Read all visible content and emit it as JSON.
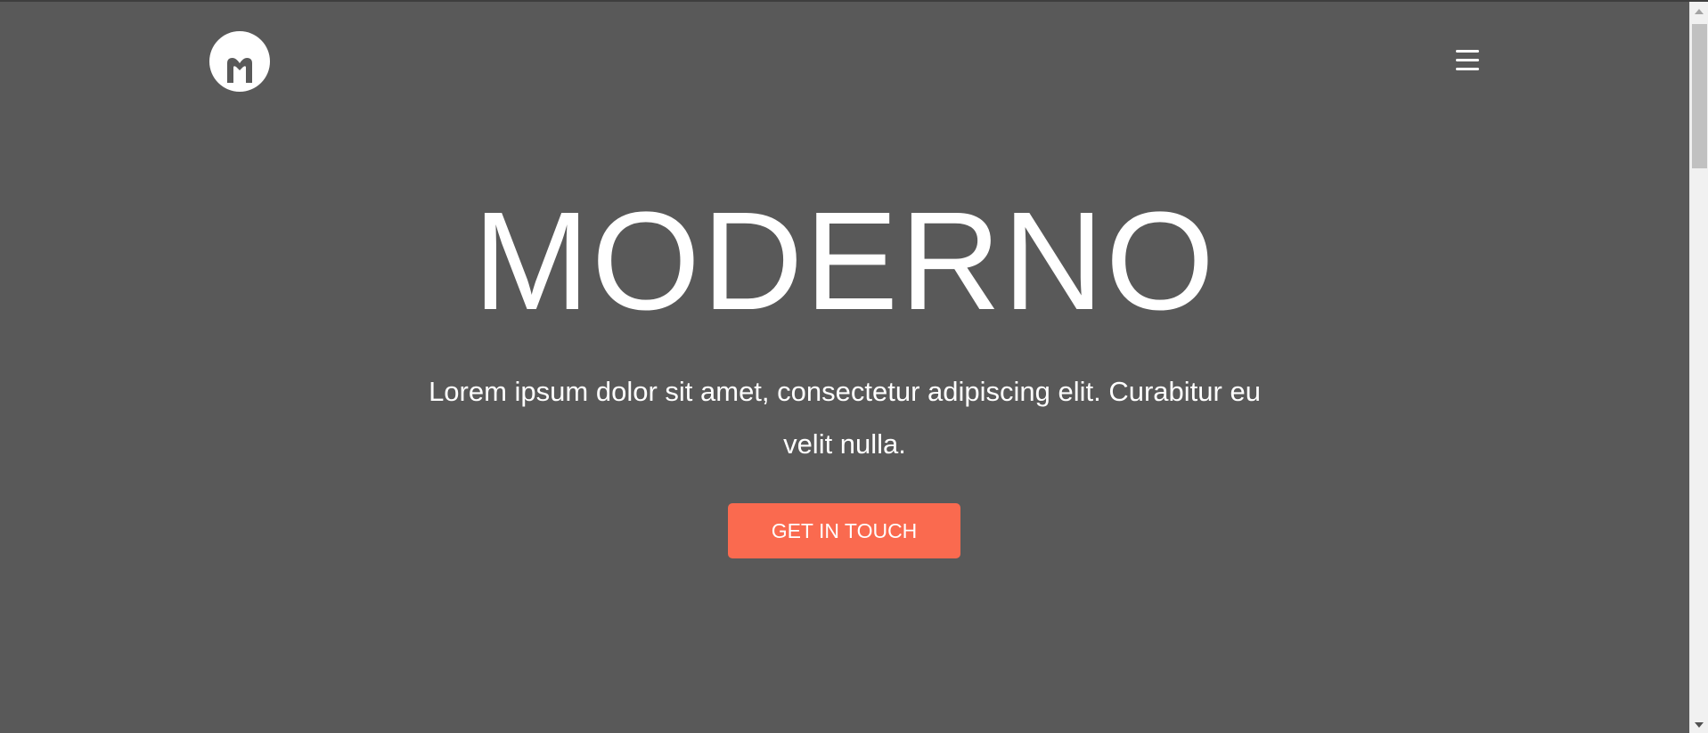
{
  "header": {
    "logo_letter": "M",
    "menu_icon": "hamburger-menu-icon"
  },
  "hero": {
    "title": "MODERNO",
    "text": "Lorem ipsum dolor sit amet, consectetur adipiscing elit. Curabitur eu velit nulla.",
    "cta_label": "GET IN TOUCH"
  },
  "colors": {
    "background": "#595959",
    "accent": "#fa6a4f",
    "text": "#ffffff"
  },
  "scrollbar": {
    "icon_up": "scroll-up-arrow-icon",
    "icon_down": "scroll-down-arrow-icon"
  }
}
